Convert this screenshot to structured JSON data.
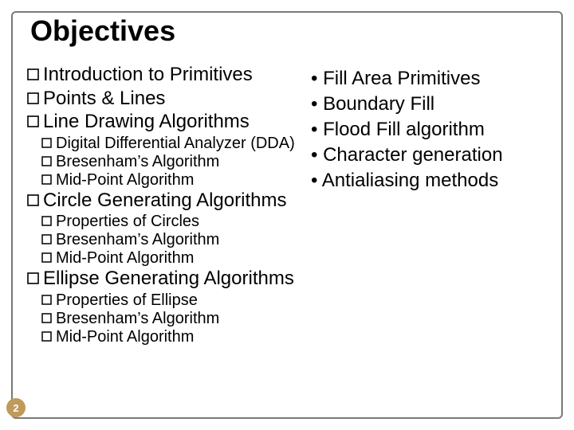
{
  "title": "Objectives",
  "left": {
    "item1": "Introduction to Primitives",
    "item2": "Points & Lines",
    "item3": "Line Drawing Algorithms",
    "item3a": "Digital Differential Analyzer (DDA)",
    "item3b": "Bresenham’s Algorithm",
    "item3c": "Mid-Point Algorithm",
    "item4": "Circle Generating Algorithms",
    "item4a": "Properties of Circles",
    "item4b": "Bresenham’s Algorithm",
    "item4c": "Mid-Point Algorithm",
    "item5": "Ellipse Generating Algorithms",
    "item5a": "Properties of Ellipse",
    "item5b": "Bresenham’s Algorithm",
    "item5c": "Mid-Point Algorithm"
  },
  "right": {
    "r1": "• Fill Area Primitives",
    "r2": "• Boundary Fill",
    "r3": "• Flood Fill algorithm",
    "r4": "• Character generation",
    "r5": "• Antialiasing methods"
  },
  "page_number": "2"
}
